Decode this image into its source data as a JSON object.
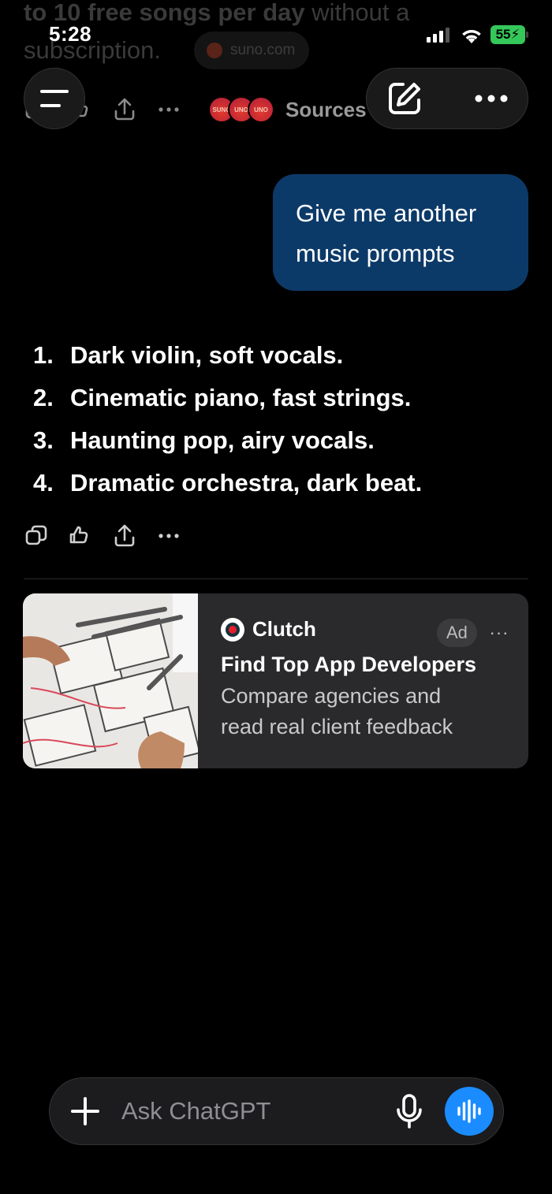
{
  "status_bar": {
    "time": "5:28",
    "battery": "55"
  },
  "previous_message": {
    "text_bold": "to 10 free songs per day",
    "text_regular": " without a subscription.",
    "source_chip": "suno.com",
    "sources_label": "Sources",
    "source_logos": [
      "SUNO",
      "UNO",
      "UNO"
    ]
  },
  "conversation": {
    "user_message": "Give me another music prompts",
    "assistant_items": [
      {
        "num": "1.",
        "text": "Dark violin, soft vocals."
      },
      {
        "num": "2.",
        "text": "Cinematic piano, fast strings."
      },
      {
        "num": "3.",
        "text": "Haunting pop, airy vocals."
      },
      {
        "num": "4.",
        "text": "Dramatic orchestra, dark beat."
      }
    ]
  },
  "ad": {
    "brand": "Clutch",
    "tag": "Ad",
    "more": "···",
    "title": "Find Top App Developers",
    "description_lines": [
      "Compare agencies and",
      "read real client feedback"
    ]
  },
  "composer": {
    "placeholder": "Ask ChatGPT"
  },
  "colors": {
    "user_bubble": "#0c3a68",
    "voice_button": "#1a8cff",
    "battery": "#34c759"
  }
}
